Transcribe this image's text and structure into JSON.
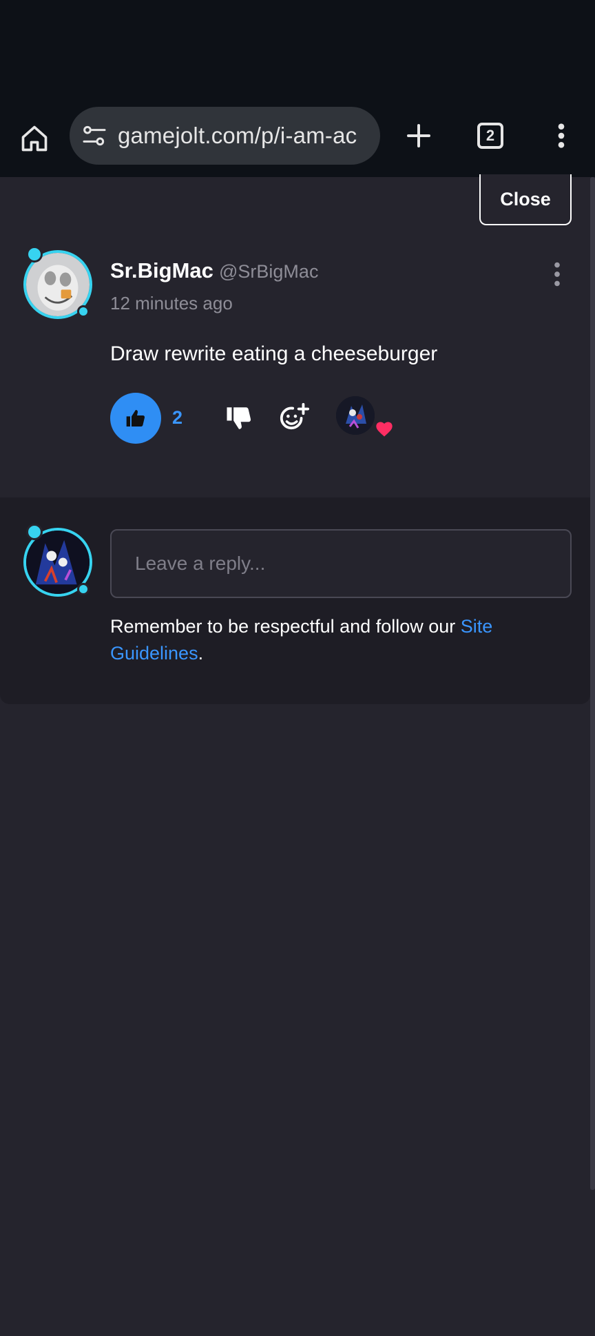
{
  "browser": {
    "url": "gamejolt.com/p/i-am-ac",
    "tab_count": "2"
  },
  "page": {
    "close_label": "Close"
  },
  "comment": {
    "author_name": "Sr.BigMac",
    "author_handle": "@SrBigMac",
    "timestamp": "12 minutes ago",
    "body": "Draw rewrite eating a cheeseburger",
    "like_count": "2"
  },
  "reply": {
    "placeholder": "Leave a reply...",
    "notice_prefix": "Remember to be respectful and follow our ",
    "notice_link": "Site Guidelines",
    "notice_suffix": "."
  },
  "colors": {
    "accent": "#2f8ef4",
    "link": "#3a96ff",
    "avatar_ring": "#37d3f0",
    "background": "#25242d",
    "heart": "#ff2e63"
  }
}
